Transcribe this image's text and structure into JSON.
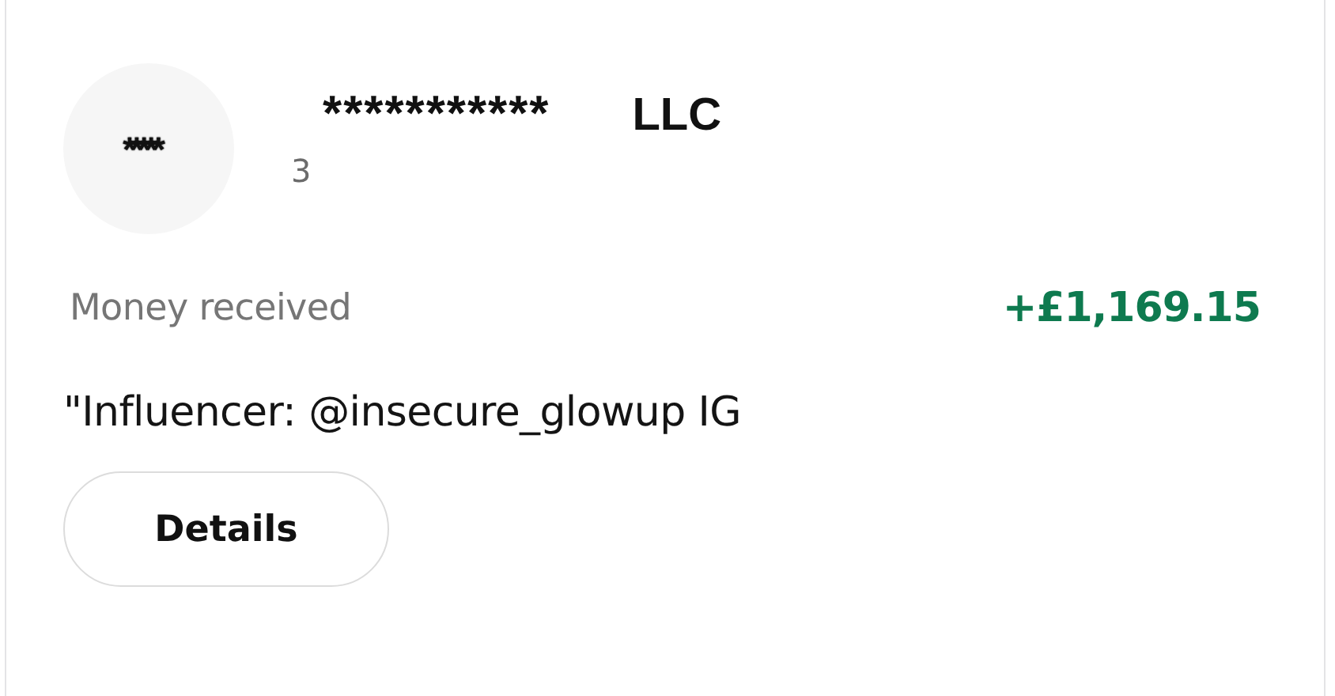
{
  "merchant": {
    "avatar_text": "*****",
    "name": "***********",
    "suffix": "LLC",
    "subtitle": "3"
  },
  "transaction": {
    "type": "Money received",
    "amount": "+£1,169.15",
    "description": "\"Influencer: @insecure_glowup IG"
  },
  "buttons": [
    "Details"
  ]
}
